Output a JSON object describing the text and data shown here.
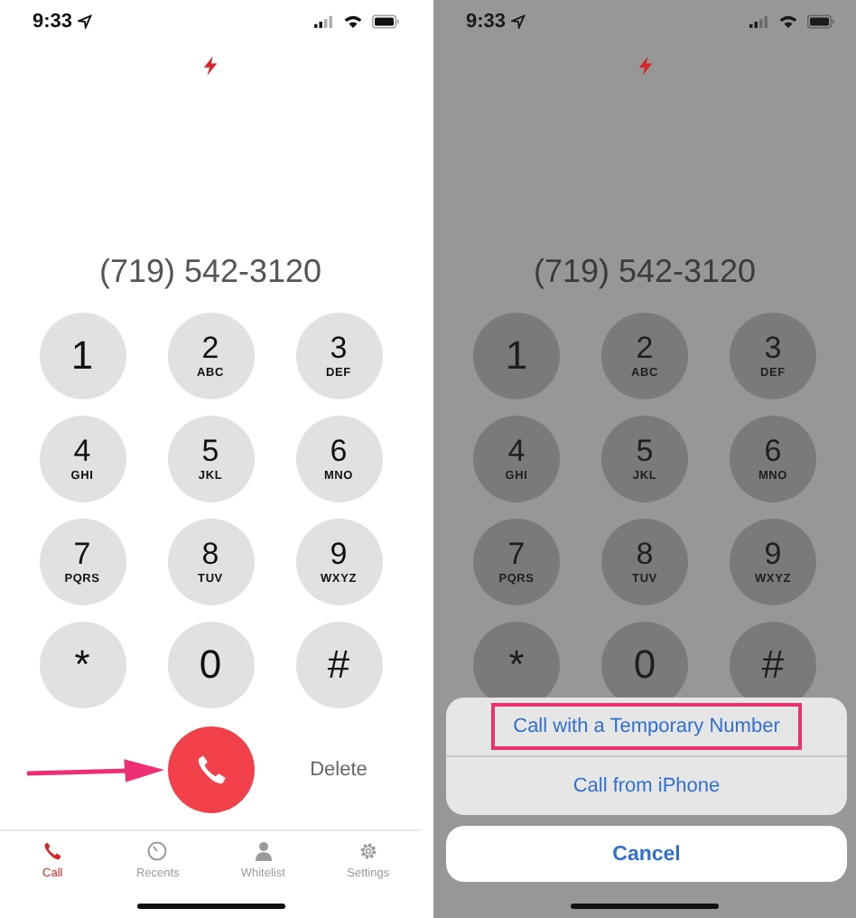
{
  "screens": [
    {
      "dimmed": false,
      "status_bar": {
        "time": "9:33"
      },
      "number": "(719) 542-3120",
      "keypad": [
        {
          "digit": "1"
        },
        {
          "digit": "2",
          "letters": "ABC"
        },
        {
          "digit": "3",
          "letters": "DEF"
        },
        {
          "digit": "4",
          "letters": "GHI"
        },
        {
          "digit": "5",
          "letters": "JKL"
        },
        {
          "digit": "6",
          "letters": "MNO"
        },
        {
          "digit": "7",
          "letters": "PQRS"
        },
        {
          "digit": "8",
          "letters": "TUV"
        },
        {
          "digit": "9",
          "letters": "WXYZ"
        },
        {
          "digit": "*"
        },
        {
          "digit": "0"
        },
        {
          "digit": "#"
        }
      ],
      "call_row": {
        "delete": "Delete",
        "pointer_arrow": true
      },
      "tab_bar": [
        {
          "label": "Call",
          "selected": true
        },
        {
          "label": "Recents",
          "selected": false
        },
        {
          "label": "Whitelist",
          "selected": false
        },
        {
          "label": "Settings",
          "selected": false
        }
      ]
    },
    {
      "dimmed": true,
      "status_bar": {
        "time": "9:33"
      },
      "number": "(719) 542-3120",
      "keypad": [
        {
          "digit": "1"
        },
        {
          "digit": "2",
          "letters": "ABC"
        },
        {
          "digit": "3",
          "letters": "DEF"
        },
        {
          "digit": "4",
          "letters": "GHI"
        },
        {
          "digit": "5",
          "letters": "JKL"
        },
        {
          "digit": "6",
          "letters": "MNO"
        },
        {
          "digit": "7",
          "letters": "PQRS"
        },
        {
          "digit": "8",
          "letters": "TUV"
        },
        {
          "digit": "9",
          "letters": "WXYZ"
        },
        {
          "digit": "*"
        },
        {
          "digit": "0"
        },
        {
          "digit": "#"
        }
      ],
      "action_sheet": {
        "actions": [
          {
            "label": "Call with a Temporary Number",
            "highlighted": true
          },
          {
            "label": "Call from iPhone",
            "highlighted": false
          }
        ],
        "cancel": "Cancel"
      }
    }
  ]
}
